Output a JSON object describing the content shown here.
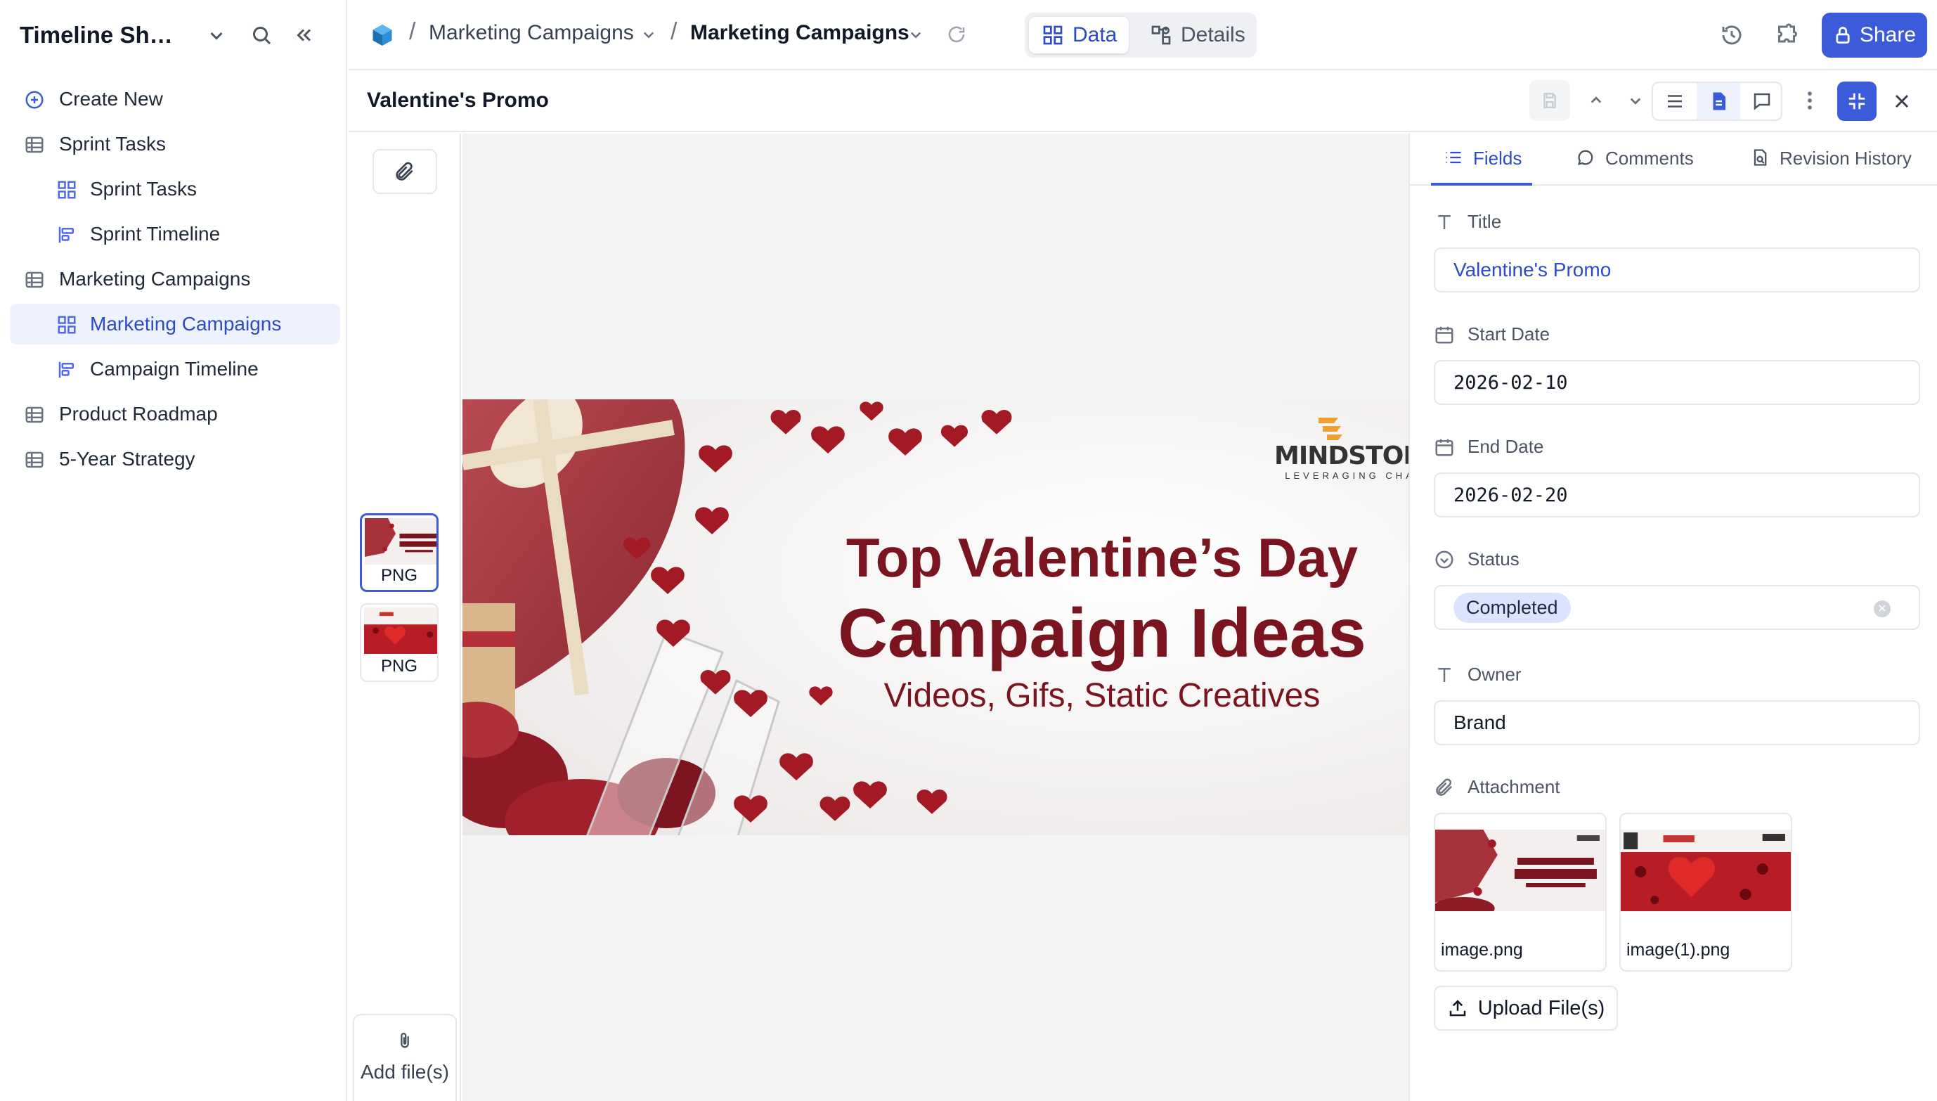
{
  "sidebar": {
    "title": "Timeline Sho...",
    "items": [
      {
        "label": "Create New",
        "icon": "plus-circle-icon",
        "level": 0
      },
      {
        "label": "Sprint Tasks",
        "icon": "table-icon",
        "level": 0
      },
      {
        "label": "Sprint Tasks",
        "icon": "grid-view-icon",
        "level": 1
      },
      {
        "label": "Sprint Timeline",
        "icon": "timeline-view-icon",
        "level": 1
      },
      {
        "label": "Marketing Campaigns",
        "icon": "table-icon",
        "level": 0
      },
      {
        "label": "Marketing Campaigns",
        "icon": "grid-view-icon",
        "level": 1,
        "active": true
      },
      {
        "label": "Campaign Timeline",
        "icon": "timeline-view-icon",
        "level": 1
      },
      {
        "label": "Product Roadmap",
        "icon": "table-icon",
        "level": 0
      },
      {
        "label": "5-Year Strategy",
        "icon": "table-icon",
        "level": 0
      }
    ]
  },
  "topbar": {
    "crumb1": "Marketing Campaigns",
    "crumb2": "Marketing Campaigns",
    "tab_data": "Data",
    "tab_details": "Details",
    "share": "Share"
  },
  "record": {
    "title": "Valentine's Promo"
  },
  "strip": {
    "thumbs": [
      "PNG",
      "PNG"
    ],
    "add_files": "Add file(s)"
  },
  "banner": {
    "brand": "MINDSTORM",
    "brand_tag": "LEVERAGING CHAOS",
    "line1": "Top Valentine’s Day",
    "line2": "Campaign Ideas",
    "line3": "Videos, Gifs, Static Creatives"
  },
  "panel": {
    "tabs": [
      "Fields",
      "Comments",
      "Revision History"
    ],
    "fields": {
      "title_label": "Title",
      "title_value": "Valentine's Promo",
      "start_label": "Start Date",
      "start_value": "2026-02-10",
      "end_label": "End Date",
      "end_value": "2026-02-20",
      "status_label": "Status",
      "status_value": "Completed",
      "owner_label": "Owner",
      "owner_value": "Brand",
      "attachment_label": "Attachment"
    },
    "attachments": [
      "image.png",
      "image(1).png"
    ],
    "upload": "Upload File(s)"
  },
  "colors": {
    "accent": "#3b5bdb",
    "active_bg": "#eef2ff",
    "status_pill": "#dbe4ff",
    "banner_text": "#7a1520"
  }
}
